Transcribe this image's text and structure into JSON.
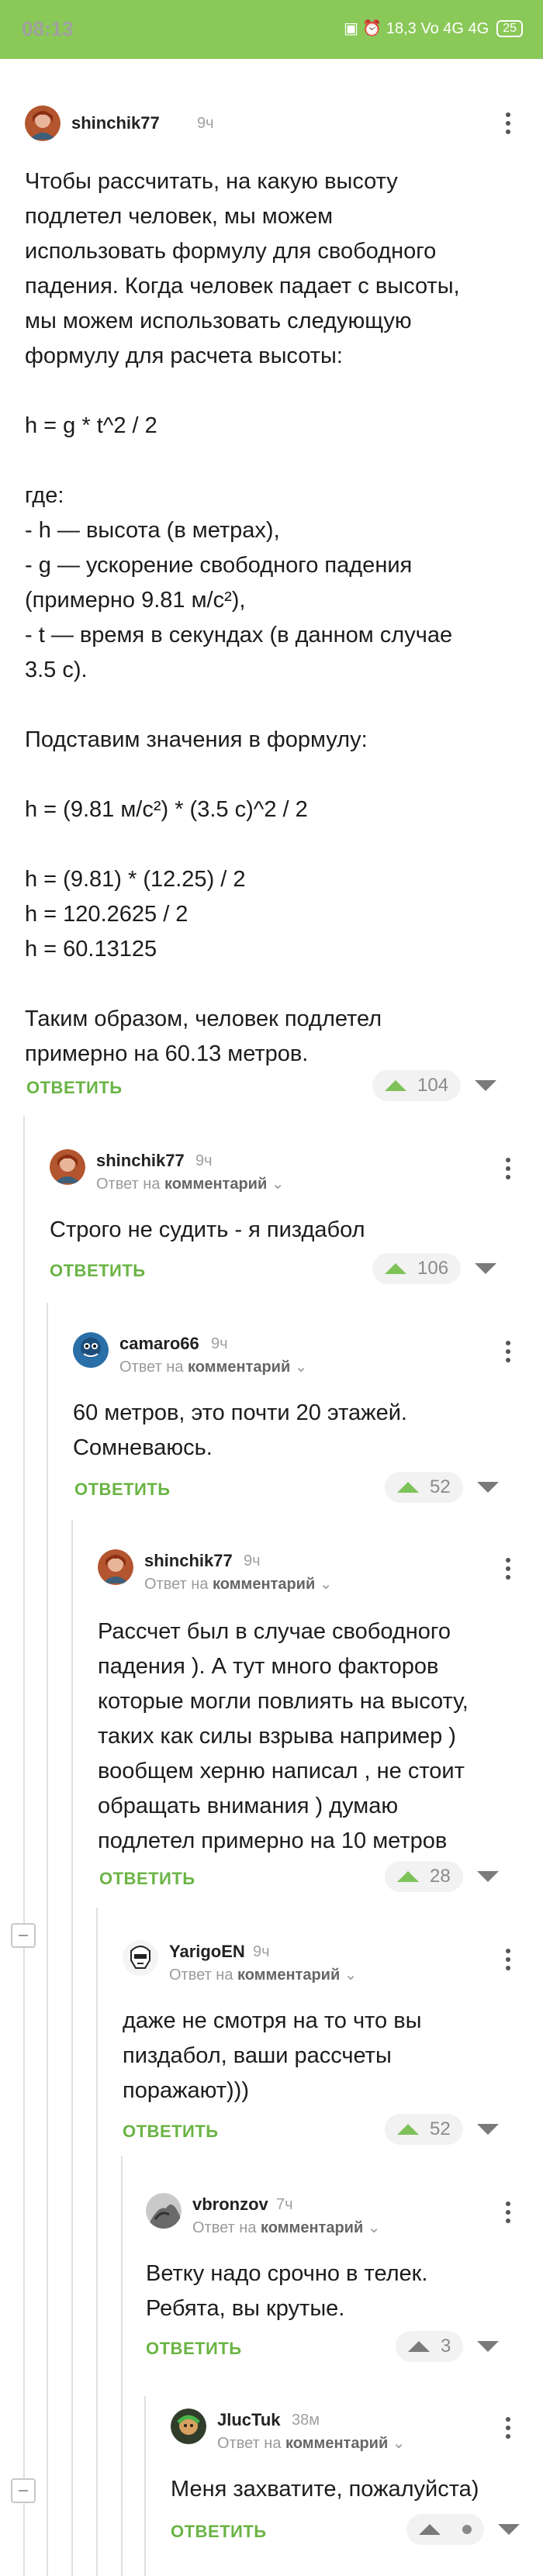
{
  "status_bar": {
    "time": "08:13",
    "icons_text": "▣ ⏰ 18,3 Vo 4G 4G",
    "battery": "25"
  },
  "comments": [
    {
      "author": "shinchik77",
      "time": "9ч",
      "text": "Чтобы рассчитать, на какую высоту\nподлетел человек, мы можем\nиспользовать формулу для свободного\nпадения. Когда человек падает с высоты,\nмы можем использовать следующую\nформулу для расчета высоты:\n\nh = g * t^2 / 2\n\nгде:\n- h — высота (в метрах),\n- g — ускорение свободного падения\n(примерно 9.81 м/с²),\n- t — время в секундах (в данном случае\n3.5 с).\n\nПодставим значения в формулу:\n\nh = (9.81 м/с²) * (3.5 с)^2 / 2\n\nh = (9.81) * (12.25) / 2\nh = 120.2625 / 2\nh = 60.13125\n\nТаким образом, человек подлетел\nпримерно на 60.13 метров.",
      "reply": "ОТВЕТИТЬ",
      "votes": "104"
    },
    {
      "author": "shinchik77",
      "time": "9ч",
      "reply_to_prefix": "Ответ на",
      "reply_to_link": "комментарий",
      "text": "Строго не судить - я пиздабол",
      "reply": "ОТВЕТИТЬ",
      "votes": "106"
    },
    {
      "author": "camaro66",
      "time": "9ч",
      "reply_to_prefix": "Ответ на",
      "reply_to_link": "комментарий",
      "text": "60 метров, это почти 20 этажей.\nСомневаюсь.",
      "reply": "ОТВЕТИТЬ",
      "votes": "52"
    },
    {
      "author": "shinchik77",
      "time": "9ч",
      "reply_to_prefix": "Ответ на",
      "reply_to_link": "комментарий",
      "text": "Рассчет был в случае свободного\nпадения ). А тут много факторов\nкоторые могли повлиять на высоту,\nтаких как силы взрыва например )\nвообщем херню написал , не стоит\nобращать внимания ) думаю\nподлетел примерно на 10 метров",
      "reply": "ОТВЕТИТЬ",
      "votes": "28"
    },
    {
      "author": "YarigoEN",
      "time": "9ч",
      "reply_to_prefix": "Ответ на",
      "reply_to_link": "комментарий",
      "text": "даже не смотря на то что вы\nпиздабол, ваши рассчеты\nпоражают)))",
      "reply": "ОТВЕТИТЬ",
      "votes": "52"
    },
    {
      "author": "vbronzov",
      "time": "7ч",
      "reply_to_prefix": "Ответ на",
      "reply_to_link": "комментарий",
      "text": "Ветку надо срочно в телек.\nРебята, вы крутые.",
      "reply": "ОТВЕТИТЬ",
      "votes": "3"
    },
    {
      "author": "JlucTuk",
      "time": "38м",
      "reply_to_prefix": "Ответ на",
      "reply_to_link": "комментарий",
      "text": "Меня захватите, пожалуйста)",
      "reply": "ОТВЕТИТЬ",
      "votes": ""
    }
  ]
}
